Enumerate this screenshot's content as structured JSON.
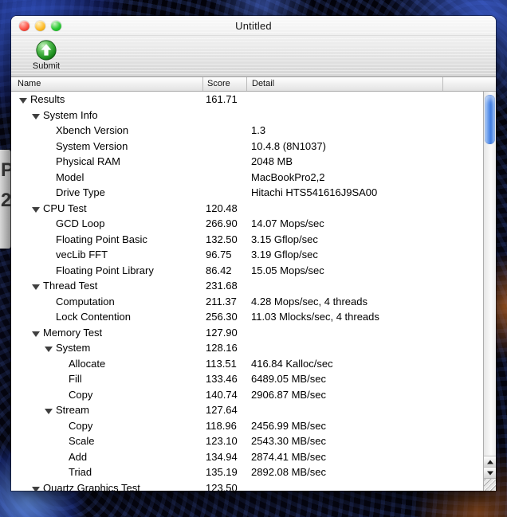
{
  "window": {
    "title": "Untitled",
    "toolbar": {
      "submit_label": "Submit",
      "submit_icon": "green-circle-up-arrow-icon"
    },
    "columns": {
      "name": "Name",
      "score": "Score",
      "detail": "Detail"
    },
    "rows": [
      {
        "level": 0,
        "expandable": true,
        "name": "Results",
        "score": "161.71",
        "detail": ""
      },
      {
        "level": 1,
        "expandable": true,
        "name": "System Info",
        "score": "",
        "detail": ""
      },
      {
        "level": 2,
        "expandable": false,
        "name": "Xbench Version",
        "score": "",
        "detail": "1.3"
      },
      {
        "level": 2,
        "expandable": false,
        "name": "System Version",
        "score": "",
        "detail": "10.4.8 (8N1037)"
      },
      {
        "level": 2,
        "expandable": false,
        "name": "Physical RAM",
        "score": "",
        "detail": "2048 MB"
      },
      {
        "level": 2,
        "expandable": false,
        "name": "Model",
        "score": "",
        "detail": "MacBookPro2,2"
      },
      {
        "level": 2,
        "expandable": false,
        "name": "Drive Type",
        "score": "",
        "detail": "Hitachi HTS541616J9SA00"
      },
      {
        "level": 1,
        "expandable": true,
        "name": "CPU Test",
        "score": "120.48",
        "detail": ""
      },
      {
        "level": 2,
        "expandable": false,
        "name": "GCD Loop",
        "score": "266.90",
        "detail": "14.07 Mops/sec"
      },
      {
        "level": 2,
        "expandable": false,
        "name": "Floating Point Basic",
        "score": "132.50",
        "detail": "3.15 Gflop/sec"
      },
      {
        "level": 2,
        "expandable": false,
        "name": "vecLib FFT",
        "score": "96.75",
        "detail": "3.19 Gflop/sec"
      },
      {
        "level": 2,
        "expandable": false,
        "name": "Floating Point Library",
        "score": "86.42",
        "detail": "15.05 Mops/sec"
      },
      {
        "level": 1,
        "expandable": true,
        "name": "Thread Test",
        "score": "231.68",
        "detail": ""
      },
      {
        "level": 2,
        "expandable": false,
        "name": "Computation",
        "score": "211.37",
        "detail": "4.28 Mops/sec, 4 threads"
      },
      {
        "level": 2,
        "expandable": false,
        "name": "Lock Contention",
        "score": "256.30",
        "detail": "11.03 Mlocks/sec, 4 threads"
      },
      {
        "level": 1,
        "expandable": true,
        "name": "Memory Test",
        "score": "127.90",
        "detail": ""
      },
      {
        "level": 2,
        "expandable": true,
        "name": "System",
        "score": "128.16",
        "detail": ""
      },
      {
        "level": 3,
        "expandable": false,
        "name": "Allocate",
        "score": "113.51",
        "detail": "416.84 Kalloc/sec"
      },
      {
        "level": 3,
        "expandable": false,
        "name": "Fill",
        "score": "133.46",
        "detail": "6489.05 MB/sec"
      },
      {
        "level": 3,
        "expandable": false,
        "name": "Copy",
        "score": "140.74",
        "detail": "2906.87 MB/sec"
      },
      {
        "level": 2,
        "expandable": true,
        "name": "Stream",
        "score": "127.64",
        "detail": ""
      },
      {
        "level": 3,
        "expandable": false,
        "name": "Copy",
        "score": "118.96",
        "detail": "2456.99 MB/sec"
      },
      {
        "level": 3,
        "expandable": false,
        "name": "Scale",
        "score": "123.10",
        "detail": "2543.30 MB/sec"
      },
      {
        "level": 3,
        "expandable": false,
        "name": "Add",
        "score": "134.94",
        "detail": "2874.41 MB/sec"
      },
      {
        "level": 3,
        "expandable": false,
        "name": "Triad",
        "score": "135.19",
        "detail": "2892.08 MB/sec"
      },
      {
        "level": 1,
        "expandable": true,
        "name": "Quartz Graphics Test",
        "score": "123.50",
        "detail": ""
      }
    ]
  },
  "background_window_fragment": {
    "letters": [
      "P",
      "2"
    ]
  },
  "colors": {
    "scrollbar_thumb_blue": "#4e8ae6",
    "submit_green": "#2f9e2f",
    "traffic_red": "#fd5549",
    "traffic_yellow": "#ffbd2e",
    "traffic_green": "#2ac833",
    "wallpaper_base": "#04040c"
  }
}
